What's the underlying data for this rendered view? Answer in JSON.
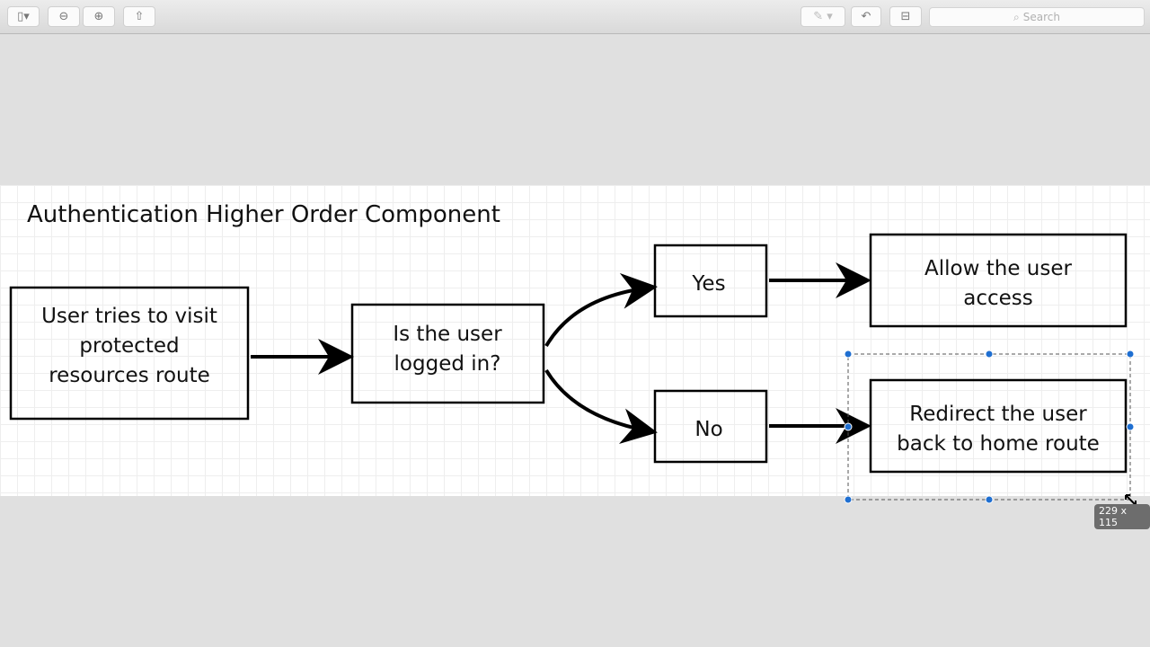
{
  "toolbar": {
    "search_placeholder": "Search"
  },
  "diagram": {
    "title": "Authentication Higher Order Component",
    "start": [
      "User tries to visit",
      "protected",
      "resources route"
    ],
    "question": [
      "Is the user",
      "logged in?"
    ],
    "yes": "Yes",
    "no": "No",
    "allow": [
      "Allow the user",
      "access"
    ],
    "redirect": [
      "Redirect the user",
      "back to home route"
    ]
  },
  "selection": {
    "size_label": "229 x 115"
  }
}
